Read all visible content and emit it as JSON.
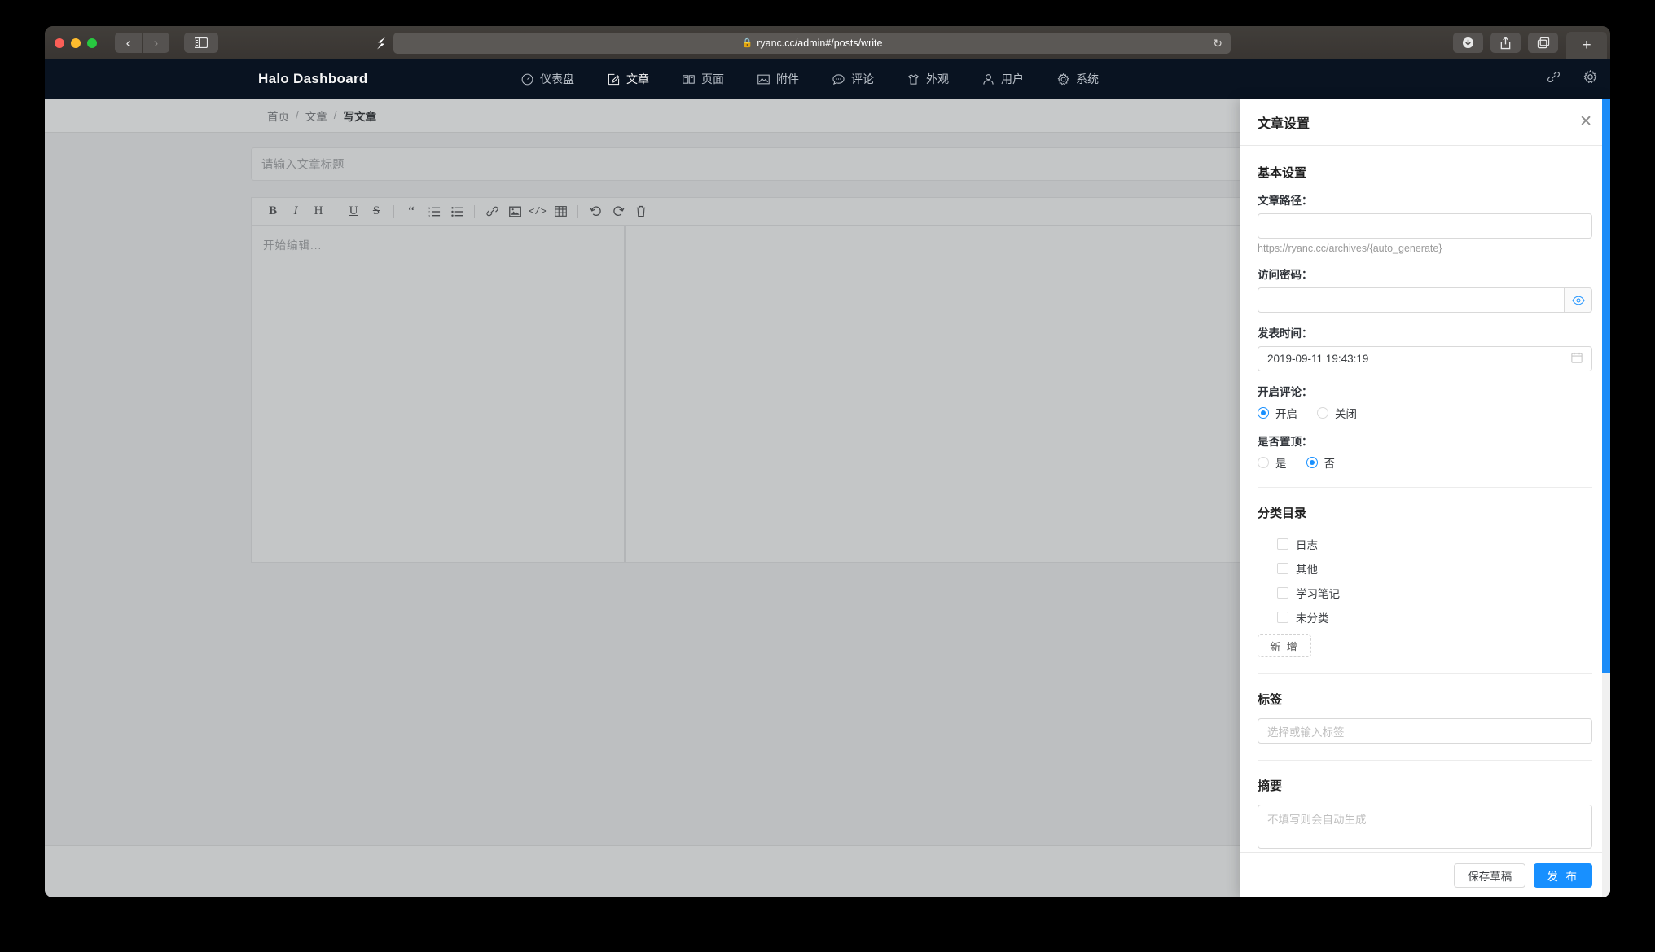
{
  "browser": {
    "url": "ryanc.cc/admin#/posts/write",
    "lock_icon": "lock-icon",
    "back_label": "‹",
    "forward_label": "›",
    "reload_label": "↻",
    "newtab_label": "+",
    "buttons": {
      "download": "download-icon",
      "share": "share-icon",
      "tabs": "tab-overview-icon"
    }
  },
  "halo": {
    "brand": "Halo  Dashboard",
    "nav": [
      {
        "label": "仪表盘",
        "icon": "dashboard-icon",
        "active": false
      },
      {
        "label": "文章",
        "icon": "edit-icon",
        "active": true
      },
      {
        "label": "页面",
        "icon": "book-icon",
        "active": false
      },
      {
        "label": "附件",
        "icon": "image-icon",
        "active": false
      },
      {
        "label": "评论",
        "icon": "comment-icon",
        "active": false
      },
      {
        "label": "外观",
        "icon": "shirt-icon",
        "active": false
      },
      {
        "label": "用户",
        "icon": "user-icon",
        "active": false
      },
      {
        "label": "系统",
        "icon": "gear-icon",
        "active": false
      }
    ],
    "nav_right": [
      {
        "icon": "link-icon"
      },
      {
        "icon": "settings-gear-icon"
      }
    ],
    "breadcrumb": [
      {
        "label": "首页",
        "current": false
      },
      {
        "label": "文章",
        "current": false
      },
      {
        "label": "写文章",
        "current": true
      }
    ],
    "separator": "/"
  },
  "editor": {
    "title_placeholder": "请输入文章标题",
    "content_placeholder": "开始编辑...",
    "toolbar": [
      {
        "name": "bold-icon",
        "glyph": "B"
      },
      {
        "name": "italic-icon",
        "glyph": "I"
      },
      {
        "name": "heading-icon",
        "glyph": "H"
      },
      {
        "name": "underline-icon",
        "glyph": "U"
      },
      {
        "name": "strikethrough-icon",
        "glyph": "S"
      },
      {
        "name": "quote-icon",
        "glyph": "❝"
      },
      {
        "name": "ordered-list-icon",
        "glyph": "☰"
      },
      {
        "name": "unordered-list-icon",
        "glyph": "☰"
      },
      {
        "name": "link-icon",
        "glyph": "🔗"
      },
      {
        "name": "image-icon",
        "glyph": "🖼"
      },
      {
        "name": "code-icon",
        "glyph": "</>"
      },
      {
        "name": "table-icon",
        "glyph": "▦"
      },
      {
        "name": "undo-icon",
        "glyph": "↺"
      },
      {
        "name": "redo-icon",
        "glyph": "↻"
      },
      {
        "name": "trash-icon",
        "glyph": "🗑"
      }
    ],
    "toolbar_right": [
      {
        "name": "outline-icon",
        "active": false
      },
      {
        "name": "eye-slash-icon",
        "active": true
      },
      {
        "name": "fullscreen-icon",
        "active": false
      }
    ]
  },
  "drawer": {
    "title": "文章设置",
    "close_label": "✕",
    "basic_section": "基本设置",
    "path": {
      "label": "文章路径：",
      "value": "",
      "hint": "https://ryanc.cc/archives/{auto_generate}"
    },
    "password": {
      "label": "访问密码：",
      "value": "",
      "eye_icon": "eye-icon"
    },
    "publish_time": {
      "label": "发表时间：",
      "value": "2019-09-11 19:43:19",
      "calendar_icon": "calendar-icon"
    },
    "comments": {
      "label": "开启评论：",
      "options": [
        {
          "label": "开启",
          "checked": true
        },
        {
          "label": "关闭",
          "checked": false
        }
      ]
    },
    "pinned": {
      "label": "是否置顶：",
      "options": [
        {
          "label": "是",
          "checked": false
        },
        {
          "label": "否",
          "checked": true
        }
      ]
    },
    "categories": {
      "title": "分类目录",
      "items": [
        {
          "label": "日志",
          "checked": false
        },
        {
          "label": "其他",
          "checked": false
        },
        {
          "label": "学习笔记",
          "checked": false
        },
        {
          "label": "未分类",
          "checked": false
        }
      ],
      "add_label": "新 增"
    },
    "tags": {
      "title": "标签",
      "placeholder": "选择或输入标签",
      "value": ""
    },
    "summary": {
      "title": "摘要",
      "placeholder": "不填写则会自动生成",
      "value": ""
    },
    "footer": {
      "save_draft": "保存草稿",
      "publish": "发 布"
    }
  },
  "colors": {
    "nav_bg": "#0a1423",
    "accent": "#1890ff",
    "page_bg": "#c5c7c9"
  }
}
